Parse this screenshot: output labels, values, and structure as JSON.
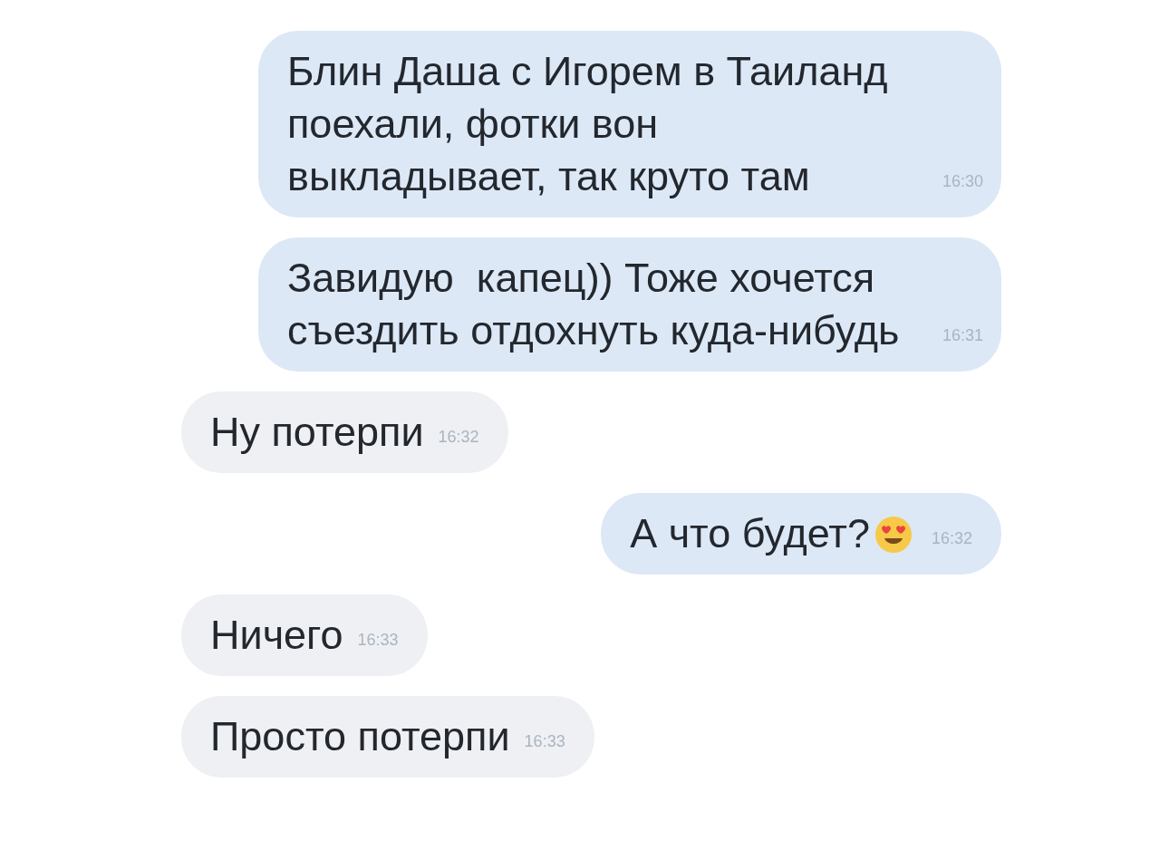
{
  "messages": [
    {
      "kind": "outgoing",
      "text": "Блин Даша с Игорем в Таиланд поехали, фотки вон выкладывает, так круто там",
      "time": "16:30",
      "has_emoji": false
    },
    {
      "kind": "outgoing",
      "text": "Завидую  капец)) Тоже хочется съездить отдохнуть куда-нибудь",
      "time": "16:31",
      "has_emoji": false
    },
    {
      "kind": "incoming",
      "text": "Ну потерпи",
      "time": "16:32",
      "has_emoji": false
    },
    {
      "kind": "outgoing",
      "text": "А что будет?",
      "time": "16:32",
      "has_emoji": true
    },
    {
      "kind": "incoming",
      "text": "Ничего",
      "time": "16:33",
      "has_emoji": false
    },
    {
      "kind": "incoming",
      "text": "Просто потерпи",
      "time": "16:33",
      "has_emoji": false
    }
  ]
}
